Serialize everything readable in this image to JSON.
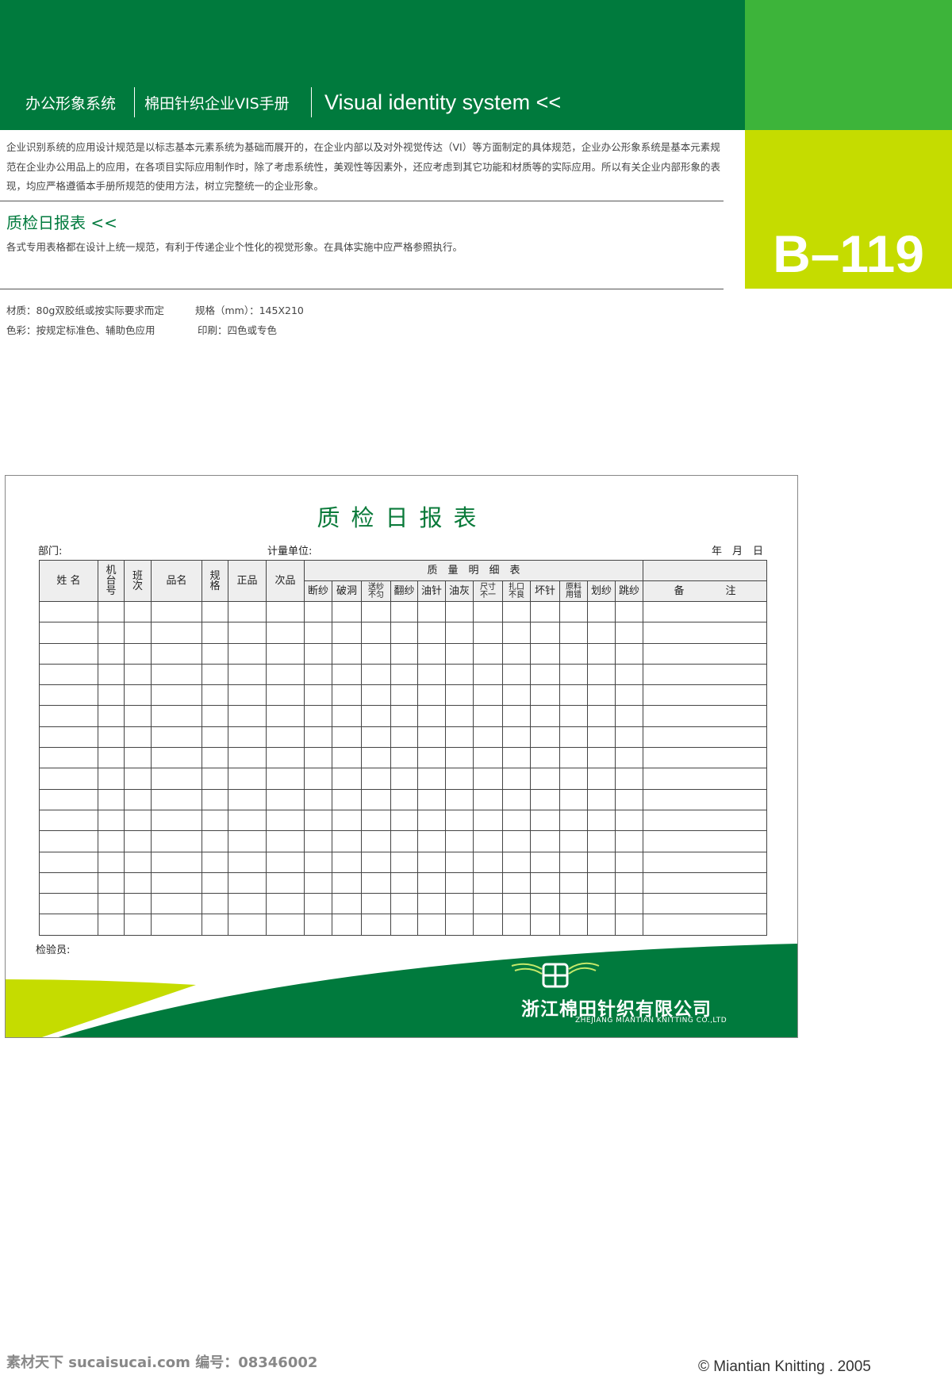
{
  "colors": {
    "dark_green": "#007a3d",
    "bright_green": "#3db43a",
    "lime": "#c5dc00"
  },
  "header": {
    "section": "办公形象系统",
    "manual": "棉田针织企业VIS手册",
    "english": "Visual identity system <<"
  },
  "page_code": "B–119",
  "intro": "企业识别系统的应用设计规范是以标志基本元素系统为基础而展开的，在企业内部以及对外视觉传达（VI）等方面制定的具体规范，企业办公形象系统是基本元素规范在企业办公用品上的应用，在各项目实际应用制作时，除了考虑系统性，美观性等因素外，还应考虑到其它功能和材质等的实际应用。所以有关企业内部形象的表现，均应严格遵循本手册所规范的使用方法，树立完整统一的企业形象。",
  "section_title": "质检日报表 <<",
  "section_desc": "各式专用表格都在设计上统一规范，有利于传递企业个性化的视觉形象。在具体实施中应严格参照执行。",
  "specs": {
    "material": "材质：80g双胶纸或按实际要求而定",
    "size": "规格（mm）：145X210",
    "color": "色彩：按规定标准色、辅助色应用",
    "print": "印刷：四色或专色"
  },
  "form": {
    "title": "质检日报表",
    "dept": "部门:",
    "unit": "计量单位:",
    "date": "年　月　日",
    "cols": {
      "name": "姓 名",
      "machine": "机台号",
      "shift": "班次",
      "product": "品名",
      "spec": "规格",
      "good": "正品",
      "defect": "次品",
      "detail": "质　量　明　细　表",
      "remark": "备　　　　注"
    },
    "defects": [
      "断纱",
      "破洞",
      "送纱不匀",
      "翻纱",
      "油针",
      "油灰",
      "尺寸不一",
      "扎口不良",
      "坏针",
      "原料用错",
      "划纱",
      "跳纱"
    ],
    "row_count": 16,
    "inspector": "检验员:",
    "company_cn": "浙江棉田针织有限公司",
    "company_en": "ZHEJIANG MIANTIAN KNITTING CO.,LTD"
  },
  "footer": {
    "watermark": "素材天下 sucaisucai.com  编号：08346002",
    "copyright": "© Miantian Knitting . 2005"
  }
}
